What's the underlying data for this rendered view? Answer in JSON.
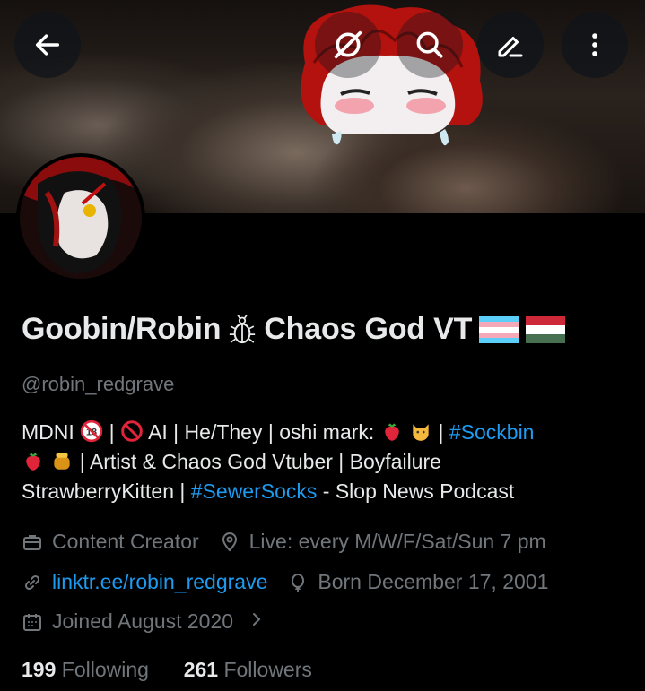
{
  "header": {
    "back_icon": "arrow-left-icon",
    "actions": [
      "sparkle-off-icon",
      "search-icon",
      "edit-icon",
      "more-vertical-icon"
    ]
  },
  "profile": {
    "name_main": "Goobin/Robin",
    "name_tail": "Chaos God VT",
    "handle": "@robin_redgrave",
    "bio": {
      "l1_a": "MDNI",
      "l1_b": "|",
      "l1_c": "AI | He/They | oshi mark:",
      "l1_d": "|",
      "hashtag1": "#Sockbin",
      "l2": "|  Artist & Chaos God Vtuber | Boyfailure",
      "l3_a": "StrawberryKitten |",
      "hashtag2": "#SewerSocks",
      "l3_b": "- Slop News Podcast"
    },
    "category": "Content Creator",
    "location": "Live: every M/W/F/Sat/Sun 7 pm",
    "website": "linktr.ee/robin_redgrave",
    "birthday": "Born December 17, 2001",
    "joined": "Joined August 2020",
    "following_count": "199",
    "following_label": "Following",
    "followers_count": "261",
    "followers_label": "Followers"
  },
  "colors": {
    "accent": "#1d9bf0",
    "muted": "#71767b",
    "text": "#e7e9ea"
  }
}
